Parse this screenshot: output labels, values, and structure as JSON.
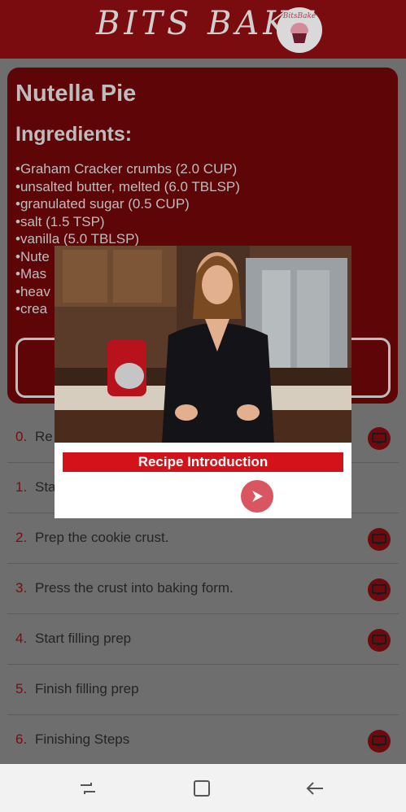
{
  "header": {
    "brand": "BITS BAKE",
    "logo_text": "BitsBake",
    "logo_icon": "cupcake-icon"
  },
  "recipe": {
    "title": "Nutella Pie",
    "ingredients_heading": "Ingredients:",
    "ingredients": [
      "Graham Cracker crumbs (2.0 CUP)",
      "unsalted butter, melted (6.0 TBLSP)",
      "granulated sugar (0.5 CUP)",
      "salt (1.5 TSP)",
      "vanilla (5.0 TBLSP)",
      "Nute",
      "Mas",
      "heav",
      "crea"
    ]
  },
  "steps": [
    {
      "num": "0.",
      "label": "Re",
      "has_video": true
    },
    {
      "num": "1.",
      "label": "Sta",
      "has_video": false
    },
    {
      "num": "2.",
      "label": "Prep the cookie crust.",
      "has_video": true
    },
    {
      "num": "3.",
      "label": "Press the crust into baking form.",
      "has_video": true
    },
    {
      "num": "4.",
      "label": "Start filling prep",
      "has_video": true
    },
    {
      "num": "5.",
      "label": "Finish filling prep",
      "has_video": false
    },
    {
      "num": "6.",
      "label": "Finishing Steps",
      "has_video": true
    }
  ],
  "popup": {
    "video_label": "Recipe Introduction",
    "next_icon": "play-arrow-icon"
  },
  "navbar": {
    "recent_icon": "recent-apps-icon",
    "home_icon": "home-icon",
    "back_icon": "back-arrow-icon"
  },
  "colors": {
    "appbar": "#7a0b0e",
    "card": "#5e0508",
    "accent_red": "#d4121a",
    "next_button": "#d95560"
  }
}
